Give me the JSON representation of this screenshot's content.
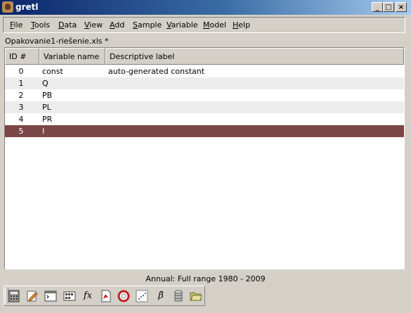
{
  "window": {
    "title": "gretl"
  },
  "menubar": {
    "items": [
      "File",
      "Tools",
      "Data",
      "View",
      "Add",
      "Sample",
      "Variable",
      "Model",
      "Help"
    ]
  },
  "file": {
    "name": "Opakovanie1-riešenie.xls *"
  },
  "table": {
    "columns": [
      "ID #",
      "Variable name",
      "Descriptive label"
    ],
    "rows": [
      {
        "id": "0",
        "name": "const",
        "label": "auto-generated constant"
      },
      {
        "id": "1",
        "name": "Q",
        "label": ""
      },
      {
        "id": "2",
        "name": "PB",
        "label": ""
      },
      {
        "id": "3",
        "name": "PL",
        "label": ""
      },
      {
        "id": "4",
        "name": "PR",
        "label": ""
      },
      {
        "id": "5",
        "name": "I",
        "label": ""
      }
    ],
    "selected_row": "5"
  },
  "status": {
    "text": "Annual: Full range 1980 - 2009"
  },
  "toolbar": {
    "icons": [
      "calculator-icon",
      "edit-notes-icon",
      "console-icon",
      "session-icon",
      "function-icon",
      "pdf-manual-icon",
      "help-lifebuoy-icon",
      "scatter-plot-icon",
      "beta-model-icon",
      "database-icon",
      "open-folder-icon"
    ],
    "function_glyph": "fx",
    "beta_glyph": "β̂"
  },
  "colors": {
    "selection": "#7b4646",
    "titlebar": "#0a246a",
    "alt_row": "#ececec"
  }
}
